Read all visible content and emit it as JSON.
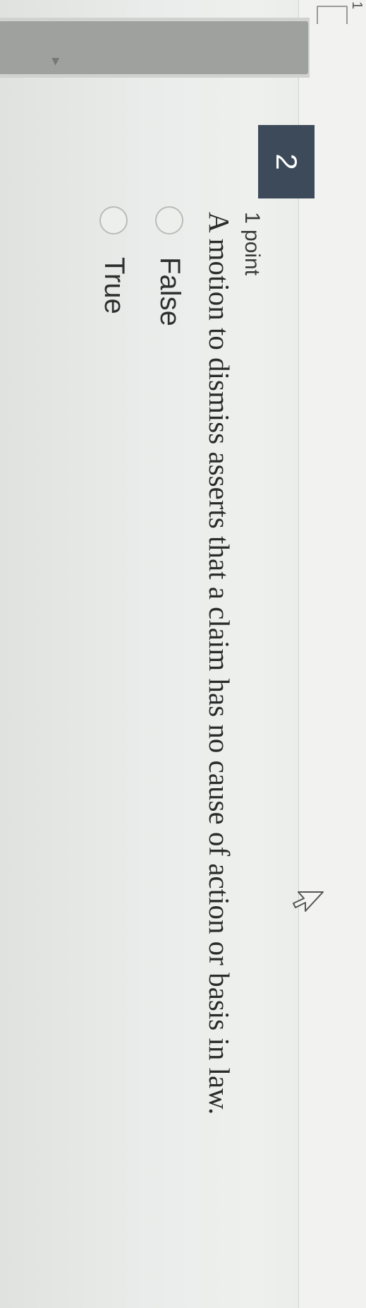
{
  "topbar": {
    "question_index_fragment": "1"
  },
  "question": {
    "number": "2",
    "points": "1 point",
    "text": "A motion to dismiss asserts that a claim has no cause of action or basis in law.",
    "options": [
      {
        "label": "False",
        "selected": false
      },
      {
        "label": "True",
        "selected": false
      }
    ]
  },
  "icons": {
    "pointer": "mouse-cursor-icon"
  }
}
